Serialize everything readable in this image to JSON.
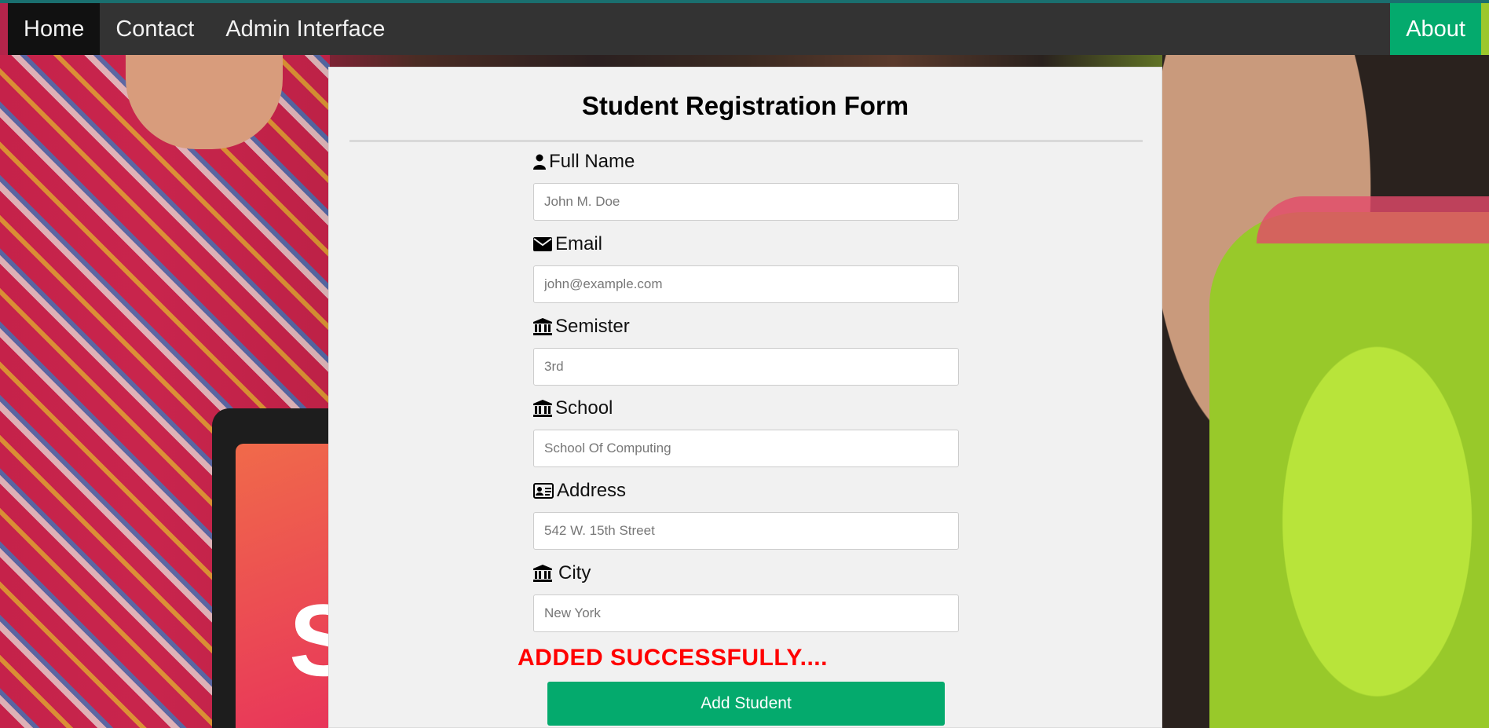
{
  "nav": {
    "items": [
      {
        "label": "Home",
        "active": true
      },
      {
        "label": "Contact",
        "active": false
      },
      {
        "label": "Admin Interface",
        "active": false
      }
    ],
    "right_item": {
      "label": "About"
    }
  },
  "form": {
    "title": "Student Registration Form",
    "fields": [
      {
        "label": "Full Name",
        "icon": "user-icon",
        "placeholder": "John M. Doe",
        "value": ""
      },
      {
        "label": "Email",
        "icon": "envelope-icon",
        "placeholder": "john@example.com",
        "value": ""
      },
      {
        "label": "Semister",
        "icon": "institution-icon",
        "placeholder": "3rd",
        "value": ""
      },
      {
        "label": "School",
        "icon": "institution-icon",
        "placeholder": "School Of Computing",
        "value": ""
      },
      {
        "label": "Address",
        "icon": "address-card-icon",
        "placeholder": "542 W. 15th Street",
        "value": ""
      },
      {
        "label": "City",
        "icon": "institution-icon",
        "placeholder": "New York",
        "value": ""
      }
    ],
    "status_message": "ADDED SUCCESSFULLY....",
    "submit_label": "Add Student"
  },
  "colors": {
    "nav_bg": "#333333",
    "nav_active": "#111111",
    "accent_green": "#04aa6d",
    "success_red": "#ff0000",
    "card_bg": "#f1f1f1"
  }
}
